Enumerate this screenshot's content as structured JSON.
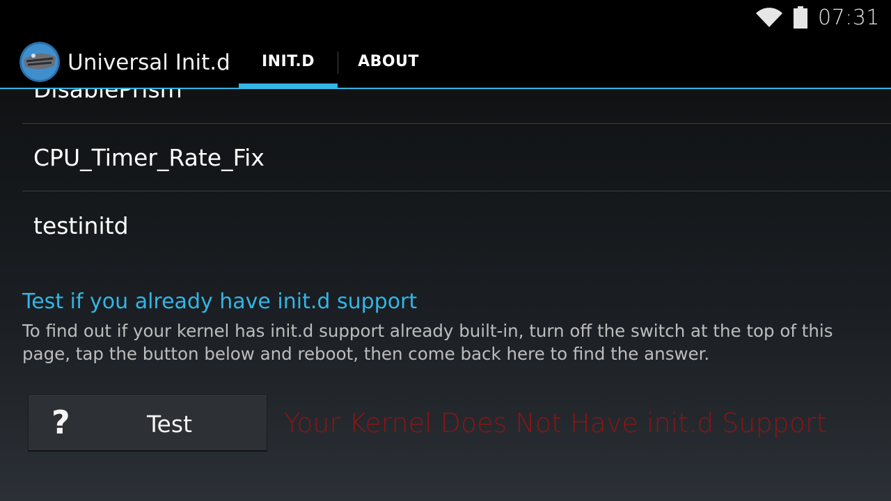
{
  "status_bar": {
    "time": "07:31",
    "wifi_icon": "wifi-icon",
    "battery_icon": "battery-icon"
  },
  "action_bar": {
    "app_title": "Universal Init.d",
    "tabs": [
      {
        "label": "INIT.D",
        "selected": true
      },
      {
        "label": "ABOUT",
        "selected": false
      }
    ],
    "accent_color": "#33b5e5"
  },
  "scripts": {
    "items": [
      {
        "label": "DisablePrism"
      },
      {
        "label": "CPU_Timer_Rate_Fix"
      },
      {
        "label": "testinitd"
      }
    ]
  },
  "test_section": {
    "title": "Test if you already have init.d support",
    "description": "To find out if your kernel has init.d support already built-in, turn off the switch at the top of this page, tap the button below and reboot, then come back here to find the answer.",
    "button_icon": "?",
    "button_label": "Test",
    "result": "Your Kernel Does Not Have init.d Support",
    "result_color": "#8b1515"
  }
}
